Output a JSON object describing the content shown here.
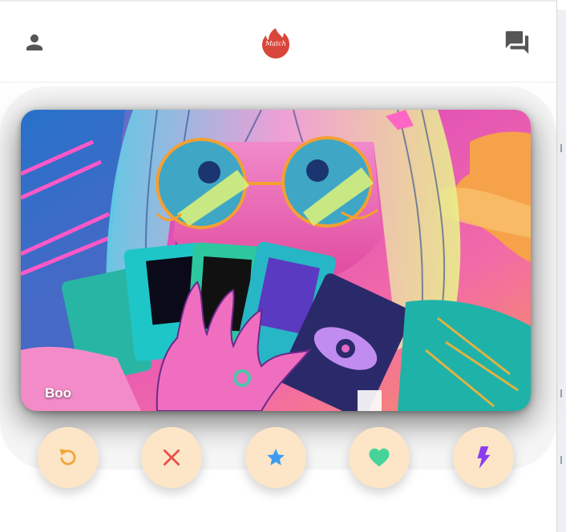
{
  "header": {
    "logo_text": "Match",
    "logo_color": "#d9463b"
  },
  "card": {
    "name": "Boo"
  },
  "actions": [
    {
      "name": "undo-button",
      "icon": "undo-icon",
      "color": "#f0a63a"
    },
    {
      "name": "nope-button",
      "icon": "close-icon",
      "color": "#e8504a"
    },
    {
      "name": "super-like-button",
      "icon": "star-icon",
      "color": "#3d9cf2"
    },
    {
      "name": "like-button",
      "icon": "heart-icon",
      "color": "#46d39a"
    },
    {
      "name": "boost-button",
      "icon": "lightning-icon",
      "color": "#8b3cf0"
    }
  ],
  "colors": {
    "action_bg": "#fde6c7",
    "icon_gray": "#555555"
  }
}
